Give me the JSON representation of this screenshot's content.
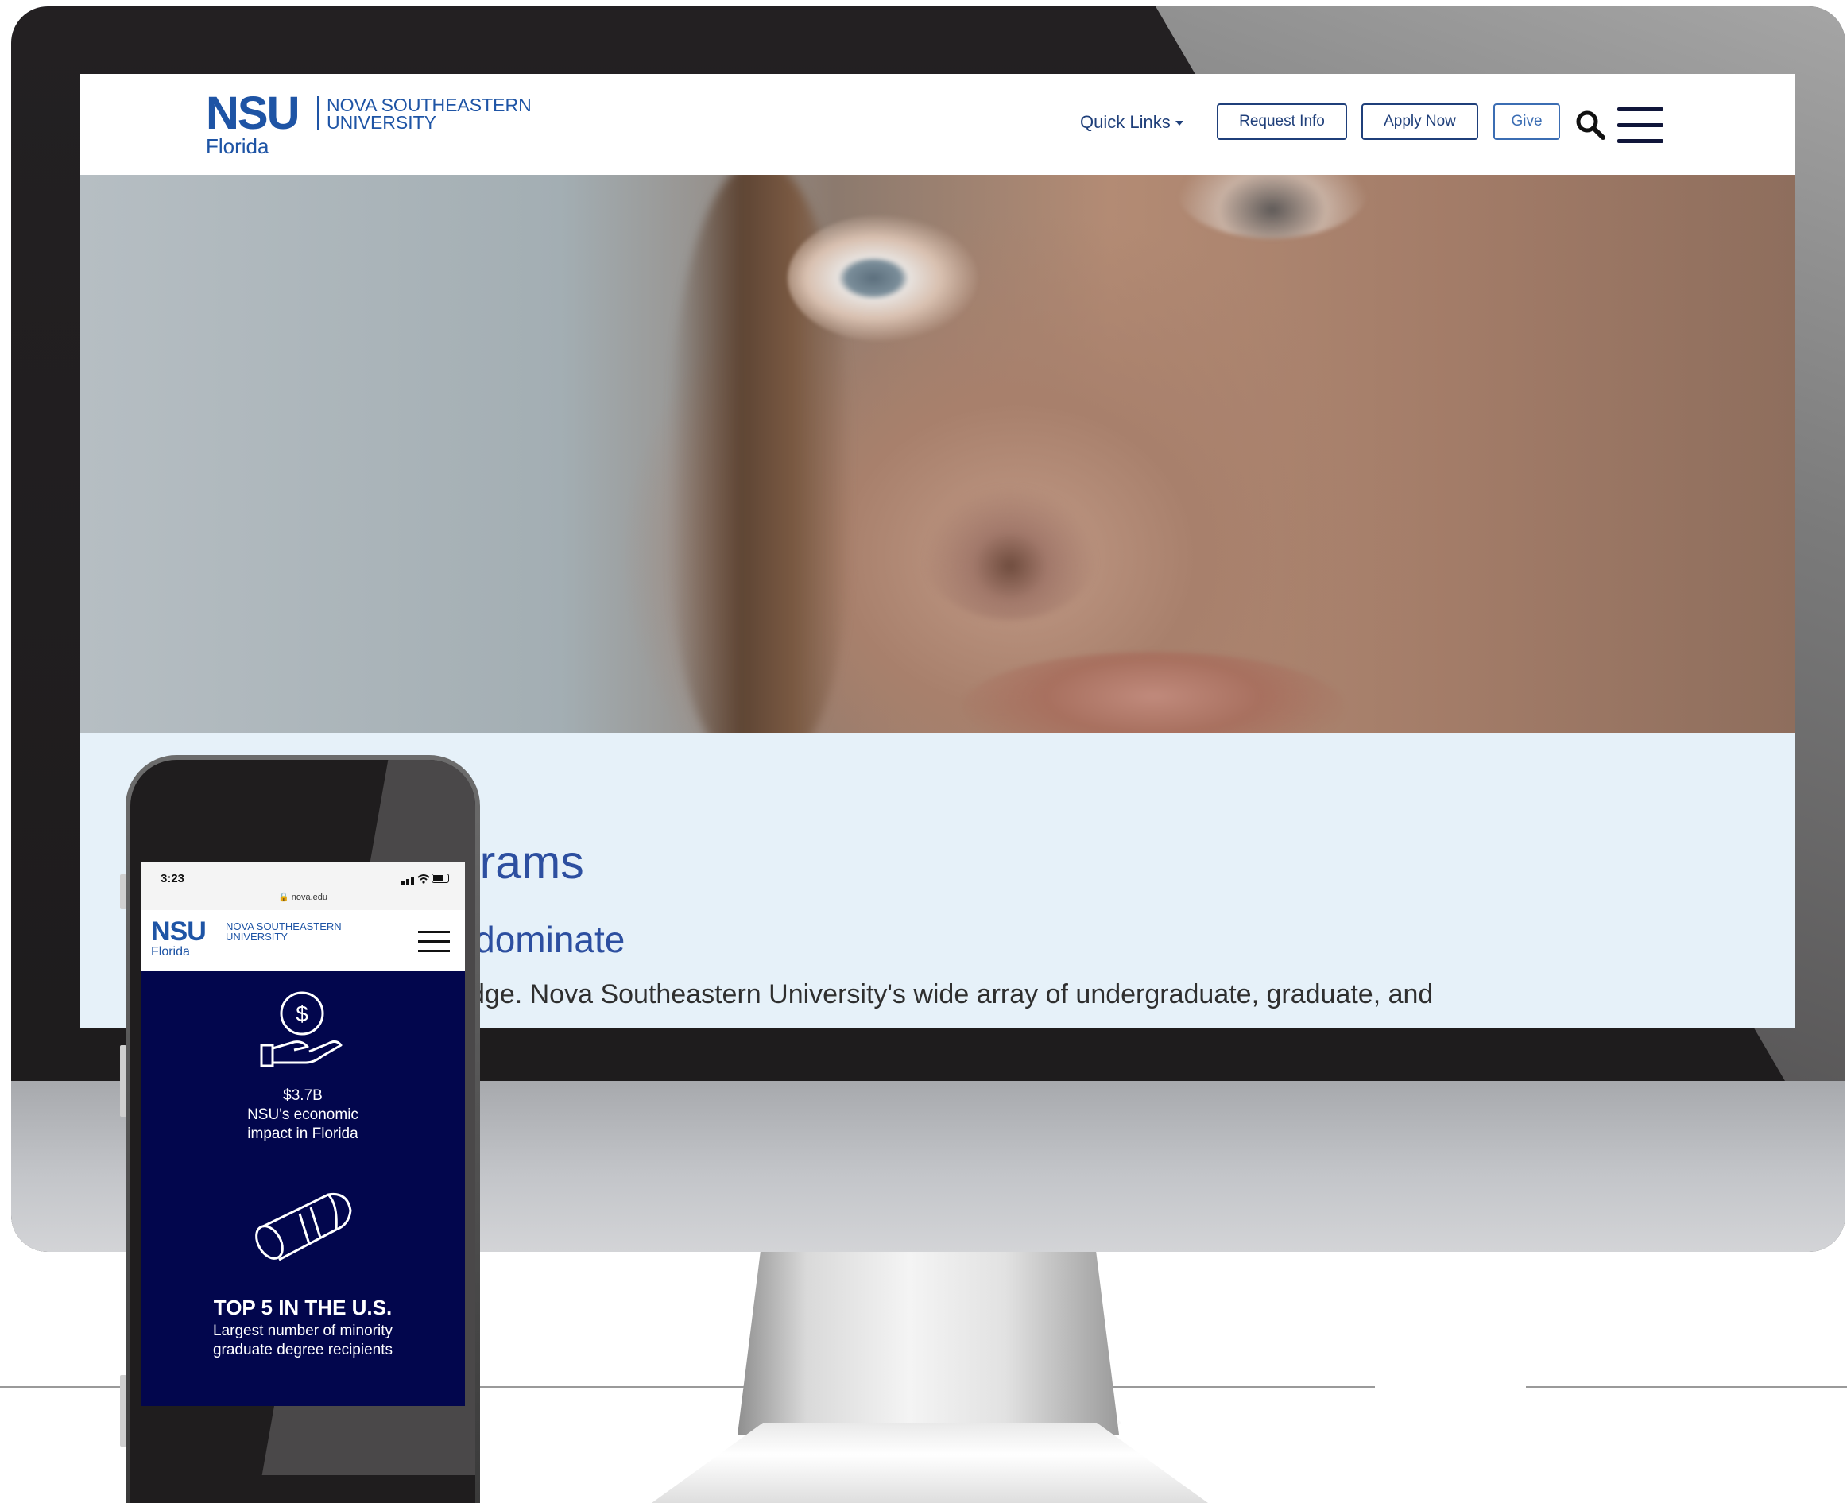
{
  "desktop_site": {
    "logo": {
      "abbr": "NSU",
      "name_line1": "NOVA SOUTHEASTERN",
      "name_line2": "UNIVERSITY",
      "location": "Florida"
    },
    "nav": {
      "quick_links": "Quick Links",
      "request_info": "Request Info",
      "apply_now": "Apply Now",
      "give": "Give",
      "search_icon": "search-icon",
      "menu_icon": "hamburger-menu-icon"
    },
    "programs": {
      "heading": "Programs",
      "subheading": "to dominate",
      "body": "dge. Nova Southeastern University's wide array of undergraduate, graduate, and"
    },
    "colors": {
      "brand_blue": "#1e54a5",
      "nav_navy": "#1f3f7a",
      "section_bg": "#e6f1f9"
    }
  },
  "mobile_site": {
    "status_bar": {
      "time": "3:23",
      "url": "nova.edu"
    },
    "logo": {
      "abbr": "NSU",
      "name_line1": "NOVA SOUTHEASTERN",
      "name_line2": "UNIVERSITY",
      "location": "Florida"
    },
    "stats": [
      {
        "icon": "dollar-hand-icon",
        "value": "$3.7B",
        "line1": "NSU's economic",
        "line2": "impact in Florida"
      },
      {
        "icon": "diploma-icon",
        "title": "TOP 5 IN THE U.S.",
        "line1": "Largest number of minority",
        "line2": "graduate degree recipients"
      }
    ],
    "colors": {
      "background": "#02064d"
    }
  }
}
